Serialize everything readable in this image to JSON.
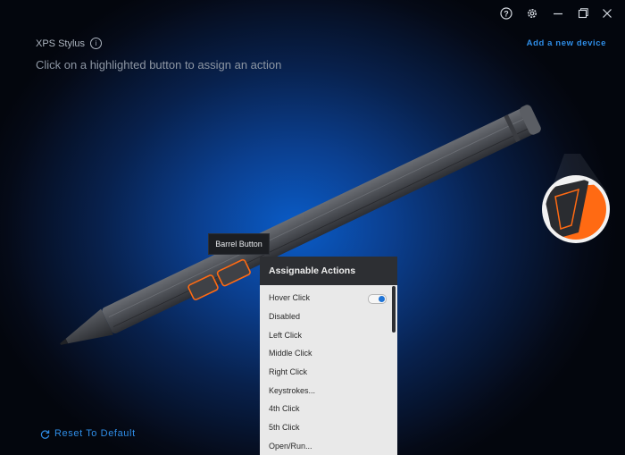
{
  "header": {
    "device_name": "XPS Stylus",
    "instruction": "Click on a highlighted button to assign an action",
    "add_device_label": "Add a new device"
  },
  "window_controls": {
    "help_icon": "question-circle-icon",
    "settings_icon": "gear-icon",
    "minimize_icon": "minimize-icon",
    "maximize_icon": "maximize-icon",
    "close_icon": "close-icon"
  },
  "tooltip": {
    "label": "Barrel Button"
  },
  "actions_panel": {
    "title": "Assignable Actions",
    "items": [
      {
        "label": "Hover Click",
        "toggle_on": true
      },
      {
        "label": "Disabled"
      },
      {
        "label": "Left Click"
      },
      {
        "label": "Middle Click"
      },
      {
        "label": "Right Click"
      },
      {
        "label": "Keystrokes..."
      },
      {
        "label": "4th Click"
      },
      {
        "label": "5th Click"
      },
      {
        "label": "Open/Run..."
      }
    ]
  },
  "footer": {
    "reset_label": "Reset To Default"
  },
  "colors": {
    "accent": "#2f8ee8",
    "highlight": "#ff6a13",
    "panel_header": "#2d2f33"
  }
}
